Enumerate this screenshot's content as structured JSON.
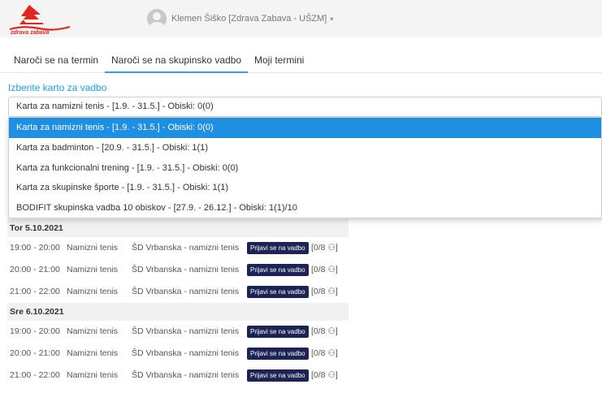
{
  "header": {
    "logo_text": "zdrava zabava",
    "user_label": "Klemen Šiško [Zdrava Zabava - UŠZM]",
    "caret": "▾"
  },
  "tabs": [
    {
      "label": "Naroči se na termin",
      "active": false
    },
    {
      "label": "Naroči se na skupinsko vadbo",
      "active": true
    },
    {
      "label": "Moji termini",
      "active": false
    }
  ],
  "card_select": {
    "label": "Izberite karto za vadbo",
    "value": "Karta za namizni tenis - [1.9. - 31.5.] - Obiski: 0(0)",
    "options": [
      "Karta za namizni tenis - [1.9. - 31.5.] - Obiski: 0(0)",
      "Karta za badminton - [20.9. - 31.5.] - Obiski: 1(1)",
      "Karta za funkcionalni trening - [1.9. - 31.5.] - Obiski: 0(0)",
      "Karta za skupinske športe - [1.9. - 31.5.] - Obiski: 1(1)",
      "BODIFIT skupinska vadba 10 obiskov - [27.9. - 26.12.] - Obiski: 1(1)/10"
    ]
  },
  "schedule": [
    {
      "day": "Tor 5.10.2021",
      "rows": [
        {
          "time": "19:00 - 20:00",
          "sport": "Namizni tenis",
          "location": "ŠD Vrbanska - namizni tenis",
          "button": "Prijavi se na vadbo",
          "capacity": "[0/8"
        },
        {
          "time": "20:00 - 21:00",
          "sport": "Namizni tenis",
          "location": "ŠD Vrbanska - namizni tenis",
          "button": "Prijavi se na vadbo",
          "capacity": "[0/8"
        },
        {
          "time": "21:00 - 22:00",
          "sport": "Namizni tenis",
          "location": "ŠD Vrbanska - namizni tenis",
          "button": "Prijavi se na vadbo",
          "capacity": "[0/8"
        }
      ]
    },
    {
      "day": "Sre 6.10.2021",
      "rows": [
        {
          "time": "19:00 - 20:00",
          "sport": "Namizni tenis",
          "location": "ŠD Vrbanska - namizni tenis",
          "button": "Prijavi se na vadbo",
          "capacity": "[0/8"
        },
        {
          "time": "20:00 - 21:00",
          "sport": "Namizni tenis",
          "location": "ŠD Vrbanska - namizni tenis",
          "button": "Prijavi se na vadbo",
          "capacity": "[0/8"
        },
        {
          "time": "21:00 - 22:00",
          "sport": "Namizni tenis",
          "location": "ŠD Vrbanska - namizni tenis",
          "button": "Prijavi se na vadbo",
          "capacity": "[0/8"
        }
      ]
    }
  ],
  "icons": {
    "capacity_icon": "people-icon",
    "user_icon": "user-avatar-icon",
    "logo_icon": "zdrava-zabava-logo"
  },
  "colors": {
    "accent": "#3a9fd6",
    "selected_option": "#1e8fe1",
    "button_bg": "#1b2453",
    "logo_red": "#e32421"
  }
}
